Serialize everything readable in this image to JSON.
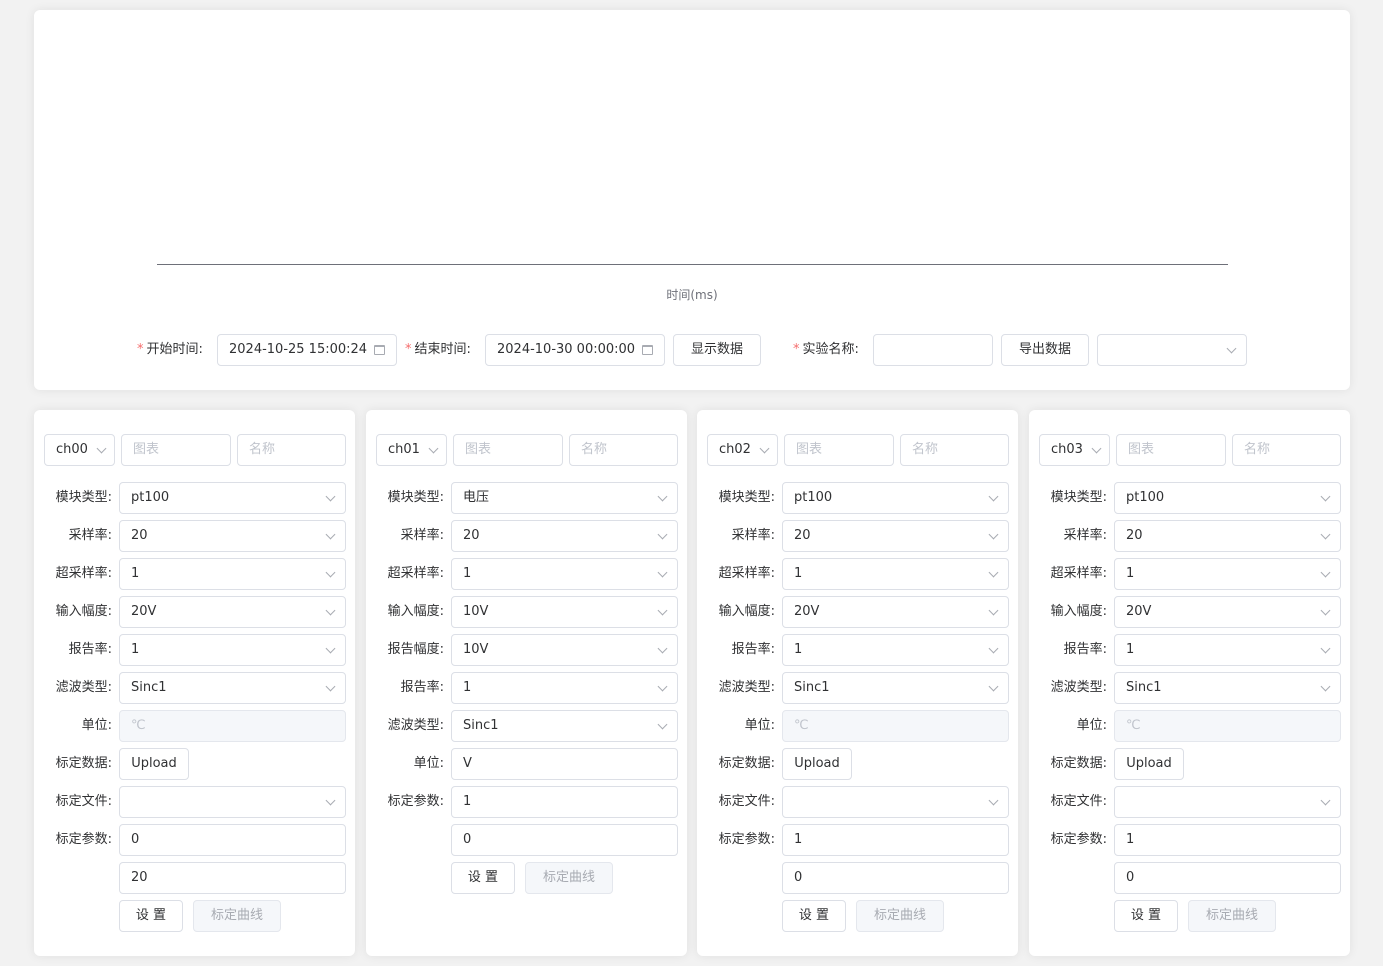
{
  "chart": {
    "xlabel": "时间(ms)"
  },
  "controls": {
    "start_label": "开始时间:",
    "start_value": "2024-10-25 15:00:24",
    "end_label": "结束时间:",
    "end_value": "2024-10-30 00:00:00",
    "show_button": "显示数据",
    "exp_label": "实验名称:",
    "exp_value": "",
    "export_button": "导出数据",
    "export_select": "",
    "required_mark": "*"
  },
  "panels": [
    {
      "channel": "ch00",
      "chart_placeholder": "图表",
      "name_placeholder": "名称",
      "rows": [
        {
          "label": "模块类型:",
          "kind": "select",
          "value": "pt100"
        },
        {
          "label": "采样率:",
          "kind": "select",
          "value": "20"
        },
        {
          "label": "超采样率:",
          "kind": "select",
          "value": "1"
        },
        {
          "label": "输入幅度:",
          "kind": "select",
          "value": "20V"
        },
        {
          "label": "报告率:",
          "kind": "select",
          "value": "1"
        },
        {
          "label": "滤波类型:",
          "kind": "select",
          "value": "Sinc1"
        },
        {
          "label": "单位:",
          "kind": "disabled",
          "value": "℃"
        },
        {
          "label": "标定数据:",
          "kind": "upload",
          "value": "Upload"
        },
        {
          "label": "标定文件:",
          "kind": "select",
          "value": ""
        },
        {
          "label": "标定参数:",
          "kind": "input",
          "value": "0"
        },
        {
          "label": "",
          "kind": "input",
          "value": "20"
        }
      ],
      "set_button": "设 置",
      "curve_button": "标定曲线"
    },
    {
      "channel": "ch01",
      "chart_placeholder": "图表",
      "name_placeholder": "名称",
      "rows": [
        {
          "label": "模块类型:",
          "kind": "select",
          "value": "电压"
        },
        {
          "label": "采样率:",
          "kind": "select",
          "value": "20"
        },
        {
          "label": "超采样率:",
          "kind": "select",
          "value": "1"
        },
        {
          "label": "输入幅度:",
          "kind": "select",
          "value": "10V"
        },
        {
          "label": "报告幅度:",
          "kind": "select",
          "value": "10V"
        },
        {
          "label": "报告率:",
          "kind": "select",
          "value": "1"
        },
        {
          "label": "滤波类型:",
          "kind": "select",
          "value": "Sinc1"
        },
        {
          "label": "单位:",
          "kind": "input",
          "value": "V"
        },
        {
          "label": "标定参数:",
          "kind": "input",
          "value": "1"
        },
        {
          "label": "",
          "kind": "input",
          "value": "0"
        }
      ],
      "set_button": "设 置",
      "curve_button": "标定曲线"
    },
    {
      "channel": "ch02",
      "chart_placeholder": "图表",
      "name_placeholder": "名称",
      "rows": [
        {
          "label": "模块类型:",
          "kind": "select",
          "value": "pt100"
        },
        {
          "label": "采样率:",
          "kind": "select",
          "value": "20"
        },
        {
          "label": "超采样率:",
          "kind": "select",
          "value": "1"
        },
        {
          "label": "输入幅度:",
          "kind": "select",
          "value": "20V"
        },
        {
          "label": "报告率:",
          "kind": "select",
          "value": "1"
        },
        {
          "label": "滤波类型:",
          "kind": "select",
          "value": "Sinc1"
        },
        {
          "label": "单位:",
          "kind": "disabled",
          "value": "℃"
        },
        {
          "label": "标定数据:",
          "kind": "upload",
          "value": "Upload"
        },
        {
          "label": "标定文件:",
          "kind": "select",
          "value": ""
        },
        {
          "label": "标定参数:",
          "kind": "input",
          "value": "1"
        },
        {
          "label": "",
          "kind": "input",
          "value": "0"
        }
      ],
      "set_button": "设 置",
      "curve_button": "标定曲线"
    },
    {
      "channel": "ch03",
      "chart_placeholder": "图表",
      "name_placeholder": "名称",
      "rows": [
        {
          "label": "模块类型:",
          "kind": "select",
          "value": "pt100"
        },
        {
          "label": "采样率:",
          "kind": "select",
          "value": "20"
        },
        {
          "label": "超采样率:",
          "kind": "select",
          "value": "1"
        },
        {
          "label": "输入幅度:",
          "kind": "select",
          "value": "20V"
        },
        {
          "label": "报告率:",
          "kind": "select",
          "value": "1"
        },
        {
          "label": "滤波类型:",
          "kind": "select",
          "value": "Sinc1"
        },
        {
          "label": "单位:",
          "kind": "disabled",
          "value": "℃"
        },
        {
          "label": "标定数据:",
          "kind": "upload",
          "value": "Upload"
        },
        {
          "label": "标定文件:",
          "kind": "select",
          "value": ""
        },
        {
          "label": "标定参数:",
          "kind": "input",
          "value": "1"
        },
        {
          "label": "",
          "kind": "input",
          "value": "0"
        }
      ],
      "set_button": "设 置",
      "curve_button": "标定曲线"
    }
  ]
}
